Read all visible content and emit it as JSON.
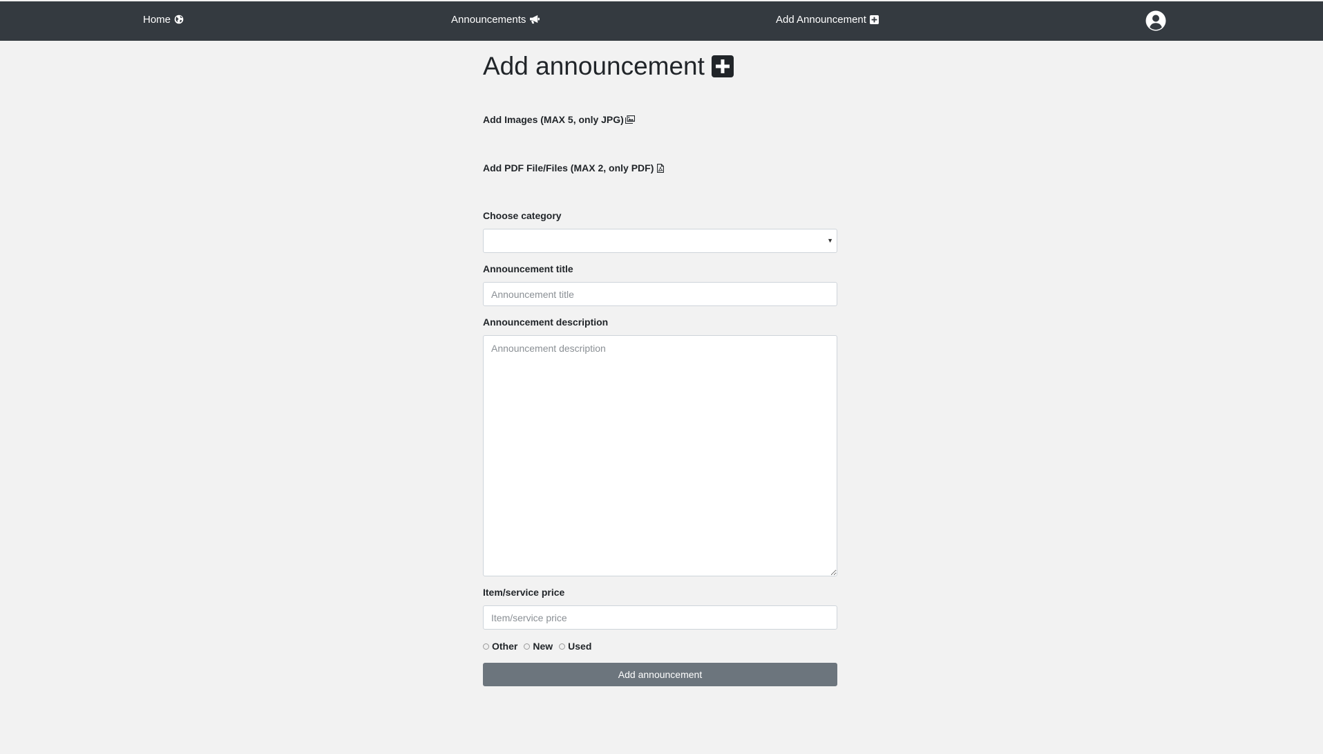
{
  "nav": {
    "home_label": "Home",
    "announcements_label": "Announcements",
    "add_announcement_label": "Add Announcement"
  },
  "page": {
    "title": "Add announcement"
  },
  "form": {
    "images_label": "Add Images (MAX 5, only JPG)",
    "pdf_label": "Add PDF File/Files (MAX 2, only PDF)",
    "category_label": "Choose category",
    "category_value": "",
    "title_label": "Announcement title",
    "title_placeholder": "Announcement title",
    "description_label": "Announcement description",
    "description_placeholder": "Announcement description",
    "price_label": "Item/service price",
    "price_placeholder": "Item/service price",
    "condition_options": [
      "Other",
      "New",
      "Used"
    ],
    "submit_label": "Add announcement"
  },
  "colors": {
    "navbar_bg": "#343a40",
    "page_bg": "#f2f2f2",
    "button_bg": "#6c757d"
  },
  "icons": {
    "home": "globe-icon",
    "announcements": "bullhorn-icon",
    "add_announcement": "plus-square-icon",
    "user": "user-circle-icon",
    "images": "images-icon",
    "pdf": "file-pdf-icon"
  }
}
